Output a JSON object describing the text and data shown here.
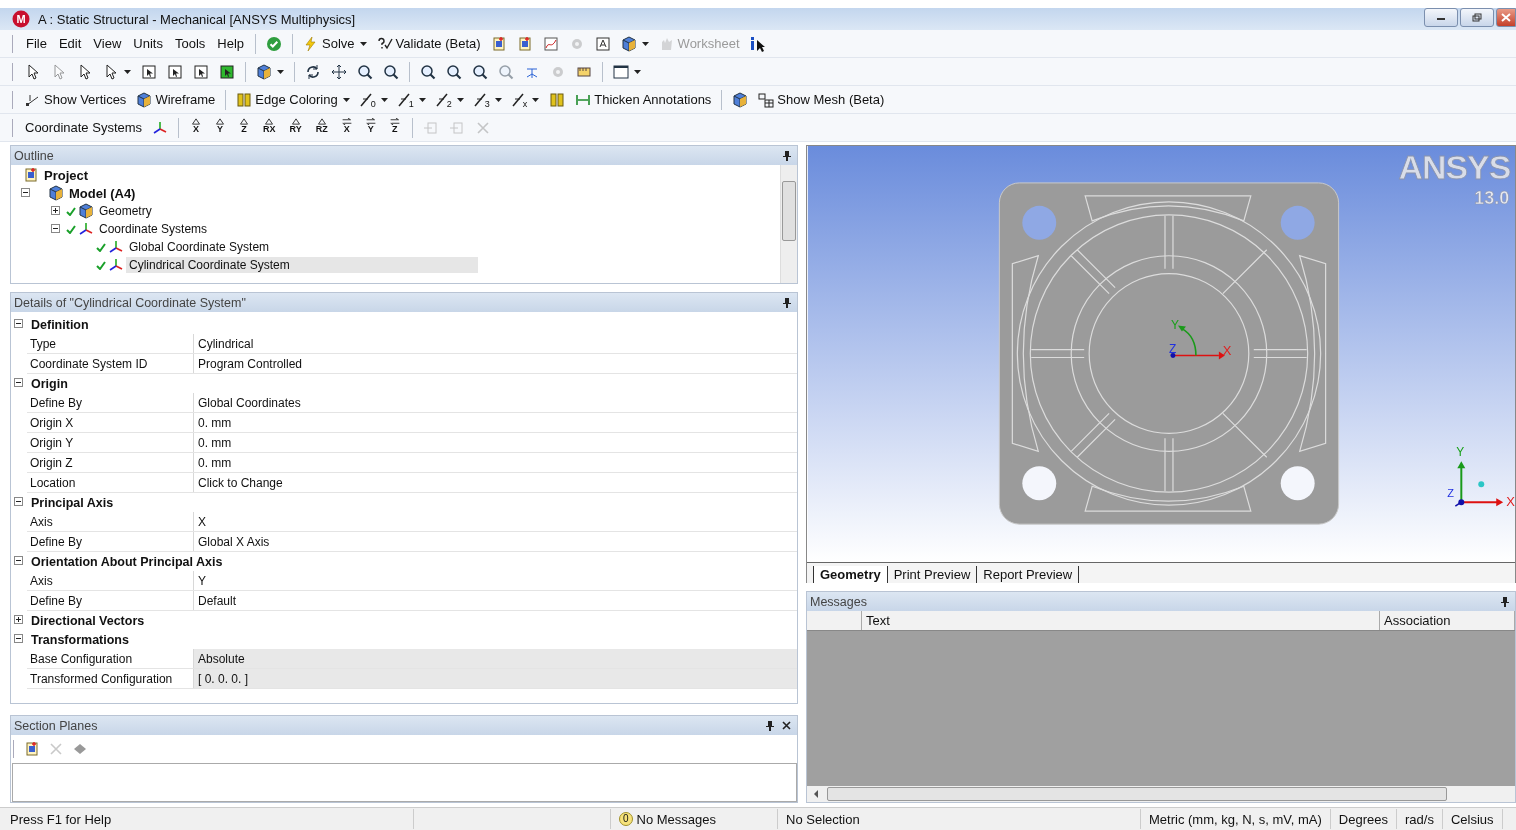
{
  "window": {
    "title": "A : Static Structural - Mechanical [ANSYS Multiphysics]",
    "app_icon_letter": "M"
  },
  "menu": [
    "File",
    "Edit",
    "View",
    "Units",
    "Tools",
    "Help"
  ],
  "toolbars": [
    [
      {
        "kind": "separator"
      },
      {
        "kind": "icon",
        "disabled": false,
        "dropdown": false
      },
      {
        "kind": "separator"
      },
      {
        "kind": "text",
        "label": "Solve",
        "disabled": false,
        "dropdown": true
      },
      {
        "kind": "text",
        "label": "Validate (Beta)",
        "disabled": false,
        "dropdown": false
      },
      {
        "kind": "icon",
        "disabled": false,
        "dropdown": false
      },
      {
        "kind": "icon",
        "disabled": false,
        "dropdown": false
      },
      {
        "kind": "icon",
        "disabled": false,
        "dropdown": false
      },
      {
        "kind": "icon",
        "disabled": true,
        "dropdown": false
      },
      {
        "kind": "icon",
        "disabled": false,
        "dropdown": false
      },
      {
        "kind": "icon",
        "disabled": false,
        "dropdown": true
      },
      {
        "kind": "text",
        "label": "Worksheet",
        "disabled": true,
        "dropdown": false
      },
      {
        "kind": "icon",
        "disabled": false,
        "dropdown": false
      }
    ],
    [
      {
        "kind": "icon",
        "disabled": false,
        "dropdown": false
      },
      {
        "kind": "icon",
        "disabled": true,
        "dropdown": false
      },
      {
        "kind": "icon",
        "disabled": false,
        "dropdown": false
      },
      {
        "kind": "icon",
        "disabled": false,
        "dropdown": true
      },
      {
        "kind": "icon",
        "disabled": false,
        "dropdown": false
      },
      {
        "kind": "icon",
        "disabled": false,
        "dropdown": false
      },
      {
        "kind": "icon",
        "disabled": false,
        "dropdown": false
      },
      {
        "kind": "icon",
        "disabled": false,
        "dropdown": false
      },
      {
        "kind": "separator"
      },
      {
        "kind": "icon",
        "disabled": false,
        "dropdown": true
      },
      {
        "kind": "separator"
      },
      {
        "kind": "icon",
        "disabled": false,
        "dropdown": false
      },
      {
        "kind": "icon",
        "disabled": false,
        "dropdown": false
      },
      {
        "kind": "icon",
        "disabled": false,
        "dropdown": false
      },
      {
        "kind": "icon",
        "disabled": false,
        "dropdown": false
      },
      {
        "kind": "separator"
      },
      {
        "kind": "icon",
        "disabled": false,
        "dropdown": false
      },
      {
        "kind": "icon",
        "disabled": false,
        "dropdown": false
      },
      {
        "kind": "icon",
        "disabled": false,
        "dropdown": false
      },
      {
        "kind": "icon",
        "disabled": true,
        "dropdown": false
      },
      {
        "kind": "icon",
        "disabled": false,
        "dropdown": false
      },
      {
        "kind": "icon",
        "disabled": true,
        "dropdown": false
      },
      {
        "kind": "icon",
        "disabled": false,
        "dropdown": false
      },
      {
        "kind": "separator"
      },
      {
        "kind": "icon",
        "disabled": false,
        "dropdown": true
      }
    ],
    [
      {
        "kind": "text",
        "label": "Show Vertices",
        "disabled": false,
        "dropdown": false
      },
      {
        "kind": "text",
        "label": "Wireframe",
        "disabled": false,
        "dropdown": false
      },
      {
        "kind": "separator"
      },
      {
        "kind": "text",
        "label": "Edge Coloring",
        "disabled": false,
        "dropdown": true
      },
      {
        "kind": "edge",
        "label": "0",
        "disabled": false,
        "dropdown": true
      },
      {
        "kind": "edge",
        "label": "1",
        "disabled": false,
        "dropdown": true
      },
      {
        "kind": "edge",
        "label": "2",
        "disabled": false,
        "dropdown": true
      },
      {
        "kind": "edge",
        "label": "3",
        "disabled": false,
        "dropdown": true
      },
      {
        "kind": "edge",
        "label": "x",
        "disabled": false,
        "dropdown": true
      },
      {
        "kind": "icon",
        "disabled": false,
        "dropdown": false
      },
      {
        "kind": "text",
        "label": "Thicken Annotations",
        "disabled": false,
        "dropdown": false
      },
      {
        "kind": "separator"
      },
      {
        "kind": "icon",
        "disabled": false,
        "dropdown": false
      },
      {
        "kind": "text",
        "label": "Show Mesh (Beta)",
        "disabled": false,
        "dropdown": false
      }
    ],
    [
      {
        "kind": "label",
        "label": "Coordinate Systems"
      },
      {
        "kind": "icon",
        "disabled": false,
        "dropdown": false
      },
      {
        "kind": "separator"
      },
      {
        "kind": "axis",
        "label": "X",
        "disabled": false
      },
      {
        "kind": "axis",
        "label": "Y",
        "disabled": false
      },
      {
        "kind": "axis",
        "label": "Z",
        "disabled": false
      },
      {
        "kind": "axis",
        "label": "RX",
        "disabled": false
      },
      {
        "kind": "axis",
        "label": "RY",
        "disabled": false
      },
      {
        "kind": "axis",
        "label": "RZ",
        "disabled": false
      },
      {
        "kind": "flip",
        "label": "X",
        "disabled": false
      },
      {
        "kind": "flip",
        "label": "Y",
        "disabled": false
      },
      {
        "kind": "flip",
        "label": "Z",
        "disabled": false
      },
      {
        "kind": "separator"
      },
      {
        "kind": "icon",
        "disabled": true,
        "dropdown": false
      },
      {
        "kind": "icon",
        "disabled": true,
        "dropdown": false
      },
      {
        "kind": "icon",
        "disabled": true,
        "dropdown": false
      }
    ]
  ],
  "outline": {
    "title": "Outline",
    "tree": [
      {
        "label": "Project",
        "ok": false,
        "selected": false,
        "children": [
          {
            "label": "Model (A4)",
            "ok": false,
            "selected": false,
            "expanded": true,
            "children": [
              {
                "label": "Geometry",
                "ok": true,
                "selected": false,
                "expanded": false
              },
              {
                "label": "Coordinate Systems",
                "ok": true,
                "selected": false,
                "expanded": true,
                "children": [
                  {
                    "label": "Global Coordinate System",
                    "ok": true,
                    "selected": false
                  },
                  {
                    "label": "Cylindrical Coordinate System",
                    "ok": true,
                    "selected": true
                  }
                ]
              }
            ]
          }
        ]
      }
    ]
  },
  "details": {
    "title": "Details of \"Cylindrical Coordinate System\"",
    "groups": [
      {
        "label": "Definition",
        "expanded": true,
        "properties": [
          {
            "name": "Type",
            "value": "Cylindrical",
            "readonly": false
          },
          {
            "name": "Coordinate System ID",
            "value": "Program Controlled",
            "readonly": false
          }
        ]
      },
      {
        "label": "Origin",
        "expanded": true,
        "properties": [
          {
            "name": "Define By",
            "value": "Global Coordinates",
            "readonly": false
          },
          {
            "name": "Origin X",
            "value": "0. mm",
            "readonly": false
          },
          {
            "name": "Origin Y",
            "value": "0. mm",
            "readonly": false
          },
          {
            "name": "Origin Z",
            "value": "0. mm",
            "readonly": false
          },
          {
            "name": "Location",
            "value": "Click to Change",
            "readonly": false
          }
        ]
      },
      {
        "label": "Principal Axis",
        "expanded": true,
        "properties": [
          {
            "name": "Axis",
            "value": "X",
            "readonly": false
          },
          {
            "name": "Define By",
            "value": "Global X Axis",
            "readonly": false
          }
        ]
      },
      {
        "label": "Orientation About Principal Axis",
        "expanded": true,
        "properties": [
          {
            "name": "Axis",
            "value": "Y",
            "readonly": false
          },
          {
            "name": "Define By",
            "value": "Default",
            "readonly": false
          }
        ]
      },
      {
        "label": "Directional Vectors",
        "expanded": false
      },
      {
        "label": "Transformations",
        "expanded": true,
        "properties": [
          {
            "name": "Base Configuration",
            "value": "Absolute",
            "readonly": true
          },
          {
            "name": "Transformed Configuration",
            "value": "[ 0. 0. 0. ]",
            "readonly": true
          }
        ]
      }
    ]
  },
  "section_planes": {
    "title": "Section Planes"
  },
  "viewport": {
    "logo": "ANSYS",
    "version": "13.0",
    "center_triad": {
      "x": "X",
      "y": "Y",
      "z": "Z"
    },
    "corner_triad": {
      "x": "X",
      "y": "Y",
      "z": "Z"
    },
    "tabs": [
      {
        "label": "Geometry",
        "selected": true
      },
      {
        "label": "Print Preview",
        "selected": false
      },
      {
        "label": "Report Preview",
        "selected": false
      }
    ]
  },
  "messages": {
    "title": "Messages",
    "columns": [
      "Text",
      "Association"
    ]
  },
  "status_bar": {
    "help": "Press F1 for Help",
    "message_count": "0",
    "messages": "No Messages",
    "selection": "No Selection",
    "units": "Metric (mm, kg, N, s, mV, mA)",
    "angle": "Degrees",
    "rate": "rad/s",
    "temperature": "Celsius"
  }
}
